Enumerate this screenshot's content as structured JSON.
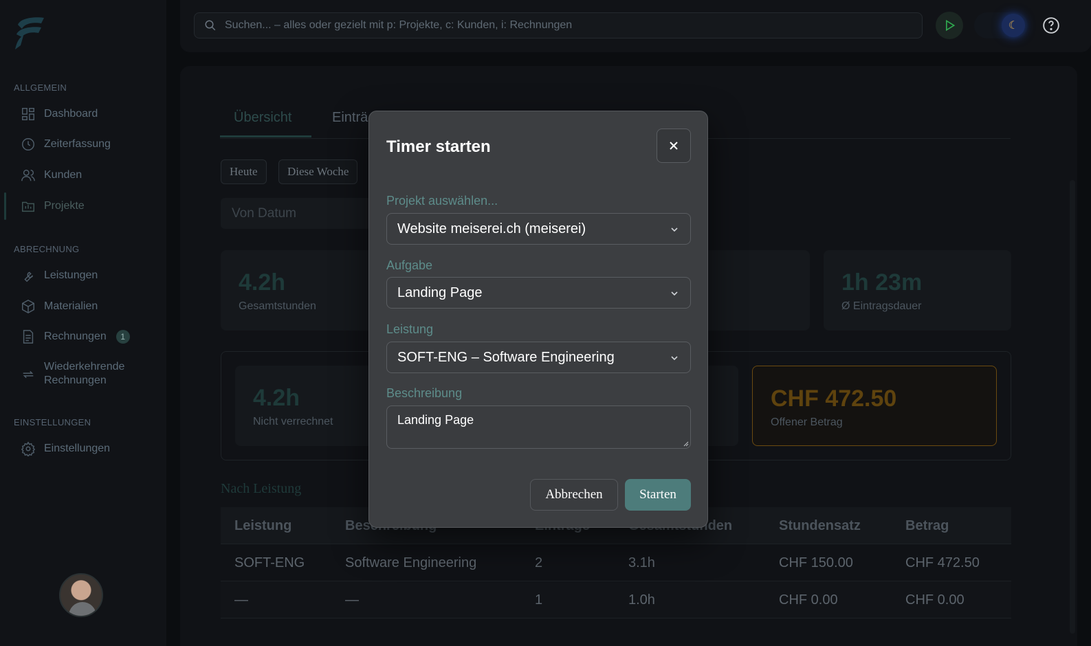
{
  "search": {
    "placeholder": "Suchen... – alles oder gezielt mit p: Projekte, c: Kunden, i: Rechnungen"
  },
  "sidebar": {
    "sections": [
      {
        "label": "ALLGEMEIN"
      },
      {
        "label": "ABRECHNUNG"
      },
      {
        "label": "EINSTELLUNGEN"
      }
    ],
    "items": [
      {
        "label": "Dashboard",
        "icon": "dashboard-icon"
      },
      {
        "label": "Zeiterfassung",
        "icon": "clock-icon"
      },
      {
        "label": "Kunden",
        "icon": "users-icon"
      },
      {
        "label": "Projekte",
        "icon": "folder-icon",
        "active": true
      },
      {
        "label": "Leistungen",
        "icon": "wrench-icon"
      },
      {
        "label": "Materialien",
        "icon": "box-icon"
      },
      {
        "label": "Rechnungen",
        "icon": "document-icon",
        "badge": "1"
      },
      {
        "label_line1": "Wiederkehrende",
        "label_line2": "Rechnungen",
        "icon": "repeat-icon"
      },
      {
        "label": "Einstellungen",
        "icon": "gear-icon"
      }
    ]
  },
  "tabs": [
    {
      "label": "Übersicht",
      "active": true
    },
    {
      "label": "Einträ"
    }
  ],
  "filters": {
    "today": "Heute",
    "this_week": "Diese Woche",
    "from_date": "Von Datum"
  },
  "stats": {
    "total_hours": {
      "value": "4.2h",
      "label": "Gesamtstunden"
    },
    "avg_duration": {
      "value": "1h 23m",
      "label": "Ø Eintragsdauer"
    },
    "unbilled": {
      "value": "4.2h",
      "label": "Nicht verrechnet"
    },
    "open_amount": {
      "value": "CHF 472.50",
      "label": "Offener Betrag"
    }
  },
  "by_service": {
    "title": "Nach Leistung",
    "headers": [
      "Leistung",
      "Beschreibung",
      "Einträge",
      "Gesamtstunden",
      "Stundensatz",
      "Betrag"
    ],
    "rows": [
      [
        "SOFT-ENG",
        "Software Engineering",
        "2",
        "3.1h",
        "CHF 150.00",
        "CHF 472.50"
      ],
      [
        "—",
        "—",
        "1",
        "1.0h",
        "CHF 0.00",
        "CHF 0.00"
      ]
    ]
  },
  "modal": {
    "title": "Timer starten",
    "project_label": "Projekt auswählen...",
    "project_value": "Website meiserei.ch (meiserei)",
    "task_label": "Aufgabe",
    "task_value": "Landing Page",
    "service_label": "Leistung",
    "service_value": "SOFT-ENG – Software Engineering",
    "description_label": "Beschreibung",
    "description_value": "Landing Page",
    "cancel_label": "Abbrechen",
    "start_label": "Starten"
  },
  "colors": {
    "accent": "#4d7c7b",
    "amount_accent": "#6b4a10",
    "play": "#2fa84f"
  }
}
